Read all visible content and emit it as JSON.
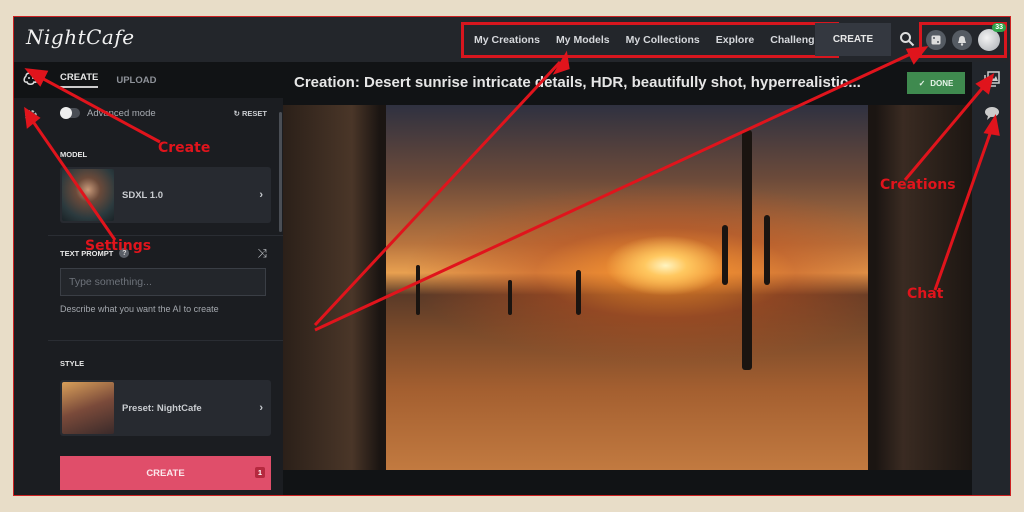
{
  "app": {
    "logo": "NightCafe"
  },
  "nav": {
    "items": [
      "My Creations",
      "My Models",
      "My Collections",
      "Explore",
      "Challenges"
    ]
  },
  "header": {
    "create_label": "CREATE",
    "notification_count": "33"
  },
  "panel": {
    "tabs": [
      "CREATE",
      "UPLOAD"
    ],
    "advanced_mode_label": "Advanced mode",
    "advanced_mode_on": false,
    "reset_label": "RESET",
    "model_label": "MODEL",
    "model_value": "SDXL 1.0",
    "text_prompt_label": "TEXT PROMPT",
    "prompt_placeholder": "Type something...",
    "prompt_value": "",
    "prompt_hint": "Describe what you want the AI to create",
    "style_label": "STYLE",
    "style_value": "Preset: NightCafe",
    "create_button": "CREATE",
    "create_count": "1"
  },
  "content": {
    "title": "Creation: Desert sunrise intricate details, HDR, beautifully shot, hyperrealistic...",
    "done_label": "DONE"
  },
  "annotations": {
    "create": "Create",
    "settings": "Settings",
    "creations": "Creations",
    "chat": "Chat",
    "color": "#e0141c"
  }
}
